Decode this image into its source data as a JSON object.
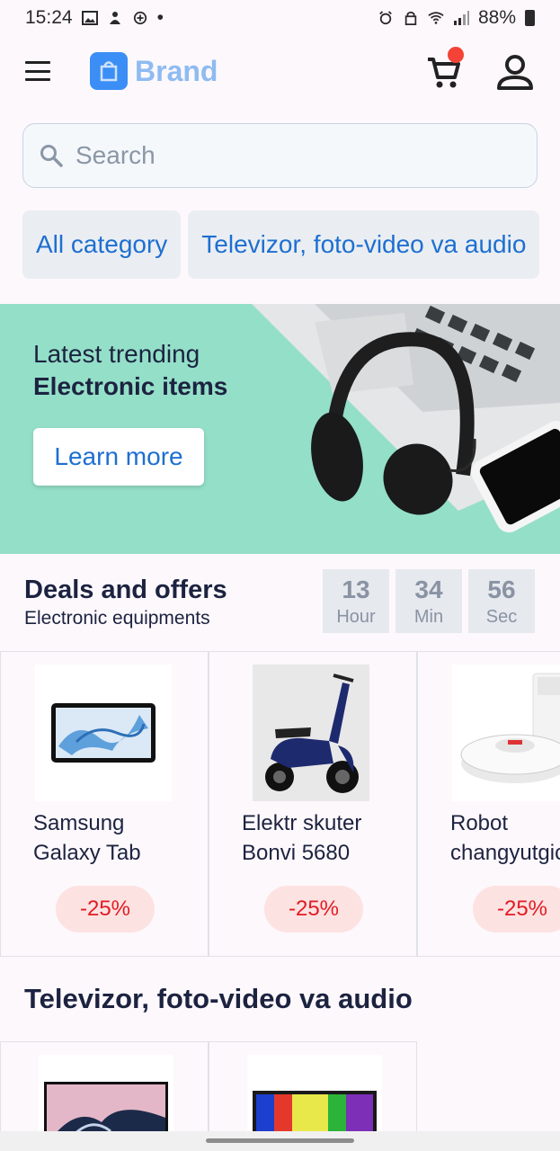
{
  "status_bar": {
    "time": "15:24",
    "dot": "•",
    "battery": "88%"
  },
  "header": {
    "brand": "Brand"
  },
  "search": {
    "placeholder": "Search"
  },
  "categories": [
    "All category",
    "Televizor, foto-video va audio"
  ],
  "banner": {
    "line1": "Latest trending",
    "line2": "Electronic items",
    "button": "Learn more"
  },
  "deals": {
    "title": "Deals and offers",
    "subtitle": "Electronic equipments",
    "timer": [
      {
        "value": "13",
        "label": "Hour"
      },
      {
        "value": "34",
        "label": "Min"
      },
      {
        "value": "56",
        "label": "Sec"
      }
    ],
    "items": [
      {
        "name1": "Samsung",
        "name2": "Galaxy Tab",
        "discount": "-25%"
      },
      {
        "name1": "Elektr skuter",
        "name2": "Bonvi 5680",
        "discount": "-25%"
      },
      {
        "name1": "Robot",
        "name2": "changyutgich",
        "discount": "-25%"
      }
    ]
  },
  "section": {
    "title": "Televizor, foto-video va audio"
  },
  "colors": {
    "accent": "#1e6fd0",
    "brand_logo": "#3b8ef5",
    "banner_bg": "#94dfc8",
    "discount": "#e31b23",
    "cart_badge": "#f44336"
  }
}
